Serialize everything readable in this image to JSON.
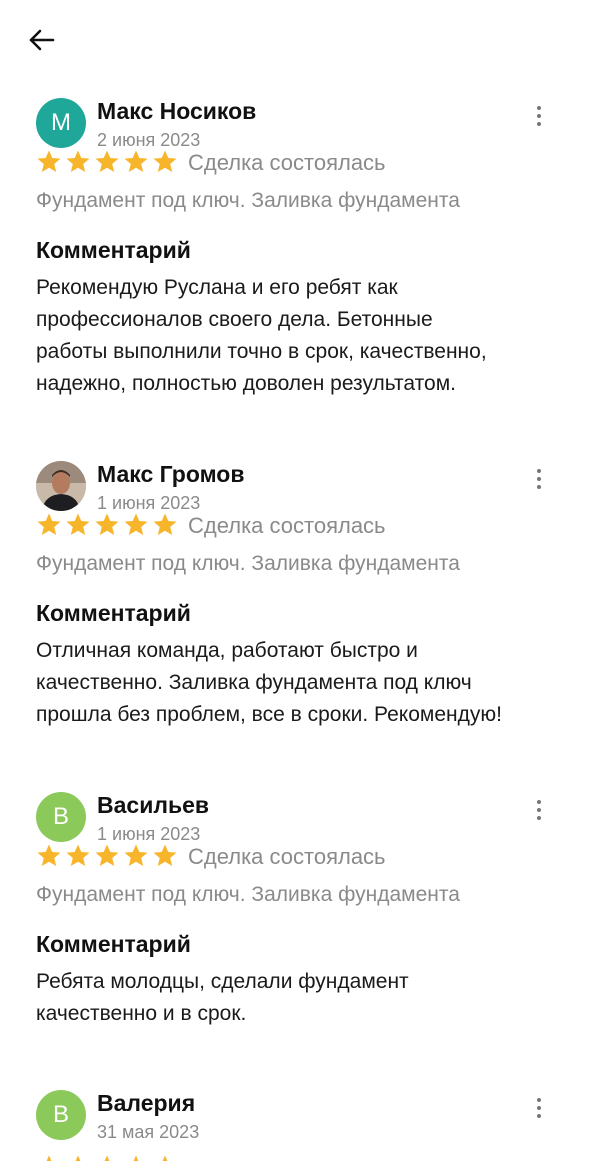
{
  "header": {
    "back_icon": "arrow-left-icon"
  },
  "reviews": [
    {
      "author": "Макс Носиков",
      "date": "2 июня 2023",
      "avatar_letter": "М",
      "avatar_color": "#1fa89a",
      "rating": 5,
      "deal_status": "Сделка состоялась",
      "service": "Фундамент под ключ. Заливка фундамента",
      "comment_heading": "Комментарий",
      "comment": "Рекомендую Руслана и его ребят как\nпрофессионалов своего дела. Бетонные\nработы выполнили точно в срок, качественно,\nнадежно, полностью доволен результатом."
    },
    {
      "author": "Макс Громов",
      "date": "1 июня 2023",
      "avatar_letter": "",
      "avatar_color": "#6b4a3a",
      "rating": 5,
      "deal_status": "Сделка состоялась",
      "service": "Фундамент под ключ. Заливка фундамента",
      "comment_heading": "Комментарий",
      "comment": "Отличная команда, работают быстро и\nкачественно. Заливка фундамента под ключ\nпрошла без проблем, все в сроки. Рекомендую!"
    },
    {
      "author": "Васильев",
      "date": "1 июня 2023",
      "avatar_letter": "В",
      "avatar_color": "#8cc95b",
      "rating": 5,
      "deal_status": "Сделка состоялась",
      "service": "Фундамент под ключ. Заливка фундамента",
      "comment_heading": "Комментарий",
      "comment": "Ребята молодцы, сделали фундамент\nкачественно и в срок."
    },
    {
      "author": "Валерия",
      "date": "31 мая 2023",
      "avatar_letter": "В",
      "avatar_color": "#8cc95b",
      "rating": 5,
      "deal_status": "",
      "service": "",
      "comment_heading": "",
      "comment": ""
    }
  ],
  "colors": {
    "star": "#f7b52b",
    "muted_text": "#8a8a8a",
    "icon": "#111111"
  }
}
